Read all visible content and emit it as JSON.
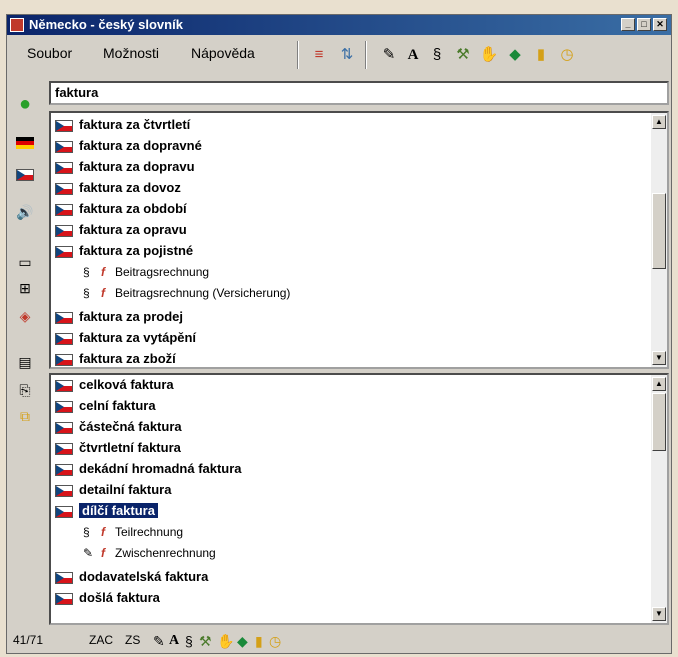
{
  "window": {
    "title": "Německo - český slovník"
  },
  "menu": [
    "Soubor",
    "Možnosti",
    "Nápověda"
  ],
  "search": {
    "value": "faktura"
  },
  "upper_list": [
    {
      "text": "faktura za čtvrtletí"
    },
    {
      "text": "faktura za dopravné"
    },
    {
      "text": "faktura za dopravu"
    },
    {
      "text": "faktura za dovoz"
    },
    {
      "text": "faktura za období"
    },
    {
      "text": "faktura za opravu"
    },
    {
      "text": "faktura za pojistné"
    },
    {
      "text": "faktura za prodej"
    },
    {
      "text": "faktura za vytápění"
    },
    {
      "text": "faktura za zboží"
    }
  ],
  "upper_sub": [
    {
      "symbol": "§",
      "text": "Beitragsrechnung"
    },
    {
      "symbol": "§",
      "text": "Beitragsrechnung (Versicherung)"
    }
  ],
  "lower_list": [
    {
      "text": "celková faktura"
    },
    {
      "text": "celní faktura"
    },
    {
      "text": "částečná faktura"
    },
    {
      "text": "čtvrtletní faktura"
    },
    {
      "text": "dekádní hromadná faktura"
    },
    {
      "text": "detailní faktura"
    },
    {
      "text": "dílčí faktura"
    },
    {
      "text": "dodavatelská faktura"
    },
    {
      "text": "došlá faktura"
    }
  ],
  "lower_sub": [
    {
      "symbol": "§",
      "text": "Teilrechnung"
    },
    {
      "symbol": "✎",
      "text": "Zwischenrechnung"
    }
  ],
  "status": {
    "count": "41/71",
    "zac": "ZAC",
    "zs": "ZS"
  }
}
